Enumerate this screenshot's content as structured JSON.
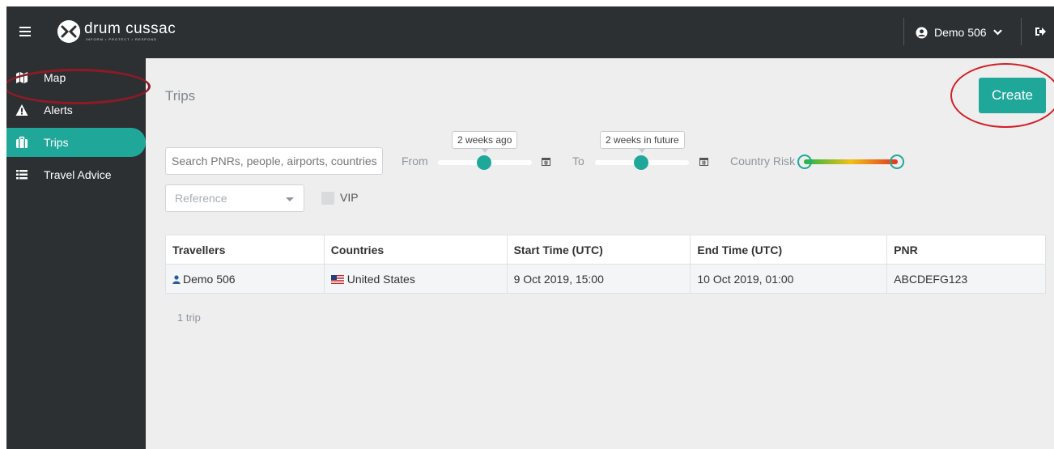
{
  "app": {
    "brand": "drum cussac",
    "tagline": "INFORM • PROTECT • RESPOND",
    "user": "Demo 506"
  },
  "sidebar": {
    "items": [
      {
        "label": "Map",
        "icon": "map-icon"
      },
      {
        "label": "Alerts",
        "icon": "warning-icon"
      },
      {
        "label": "Trips",
        "icon": "briefcase-icon"
      },
      {
        "label": "Travel Advice",
        "icon": "list-icon"
      }
    ],
    "active": "Trips"
  },
  "main": {
    "title": "Trips",
    "create_label": "Create",
    "filters": {
      "search_placeholder": "Search PNRs, people, airports, countries...",
      "from_label": "From",
      "from_value": "2 weeks ago",
      "to_label": "To",
      "to_value": "2 weeks in future",
      "country_risk_label": "Country Risk",
      "reference_placeholder": "Reference",
      "vip_label": "VIP"
    },
    "table": {
      "columns": [
        "Travellers",
        "Countries",
        "Start Time (UTC)",
        "End Time (UTC)",
        "PNR"
      ],
      "rows": [
        {
          "traveller": "Demo 506",
          "country": "United States",
          "start": "9 Oct 2019, 15:00",
          "end": "10 Oct 2019, 01:00",
          "pnr": "ABCDEFG123"
        }
      ]
    },
    "count_text": "1 trip"
  },
  "colors": {
    "accent": "#1fa89a",
    "chrome": "#2d3033",
    "annotation_red": "#d21f26",
    "annotation_maroon": "#8e1a26"
  }
}
